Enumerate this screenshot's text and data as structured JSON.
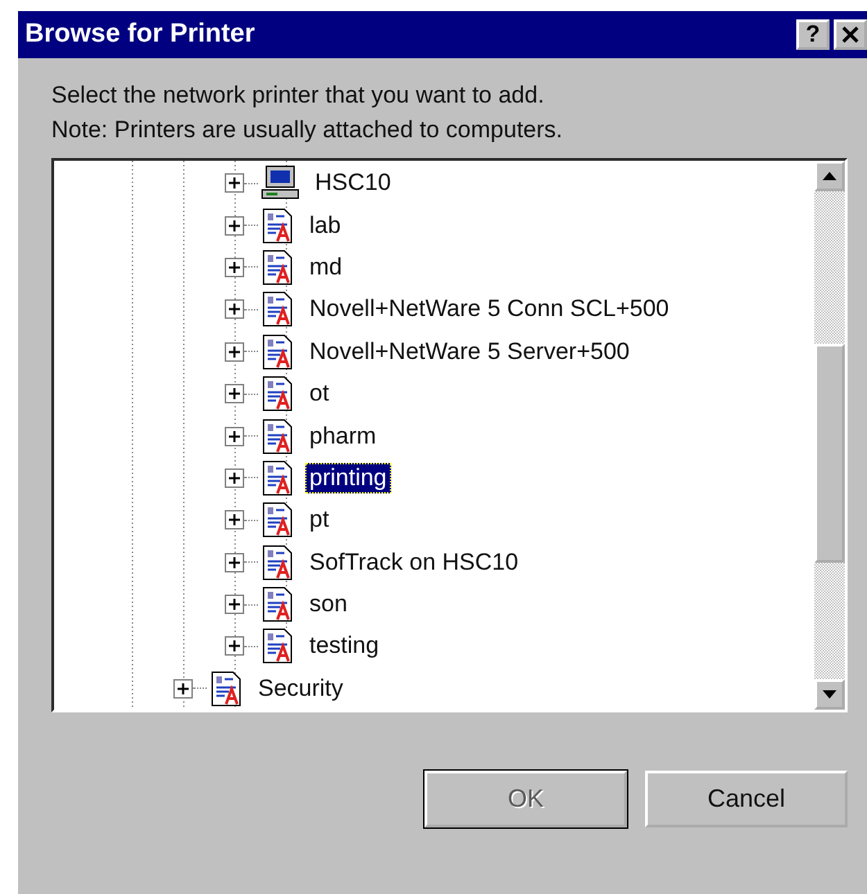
{
  "window": {
    "title": "Browse for Printer",
    "help_button": "?"
  },
  "instructions": [
    "Select the network printer that you want to add.",
    "Note: Printers are usually attached to computers."
  ],
  "tree": {
    "items": [
      {
        "children": [
          {
            "label": "HSC10",
            "kind": "computer",
            "selected": false
          },
          {
            "label": "lab",
            "kind": "printers",
            "selected": false
          },
          {
            "label": "md",
            "kind": "printers",
            "selected": false
          },
          {
            "label": "Novell+NetWare 5 Conn SCL+500",
            "kind": "printers",
            "selected": false
          },
          {
            "label": "Novell+NetWare 5 Server+500",
            "kind": "printers",
            "selected": false
          },
          {
            "label": "ot",
            "kind": "printers",
            "selected": false
          },
          {
            "label": "pharm",
            "kind": "printers",
            "selected": false
          },
          {
            "label": "printing",
            "kind": "printers",
            "selected": true
          },
          {
            "label": "pt",
            "kind": "printers",
            "selected": false
          },
          {
            "label": "SofTrack on HSC10",
            "kind": "printers",
            "selected": false
          },
          {
            "label": "son",
            "kind": "printers",
            "selected": false
          },
          {
            "label": "testing",
            "kind": "printers",
            "selected": false
          }
        ]
      },
      {
        "label": "Security",
        "kind": "printers",
        "selected": false
      }
    ]
  },
  "buttons": [
    {
      "label": "OK",
      "disabled": true
    },
    {
      "label": "Cancel",
      "disabled": false
    }
  ]
}
